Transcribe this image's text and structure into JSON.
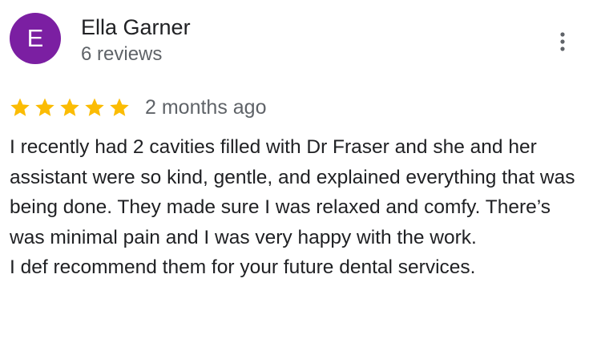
{
  "review": {
    "author": {
      "avatar_letter": "E",
      "avatar_color": "#7b1fa2",
      "name": "Ella Garner",
      "review_count": "6 reviews"
    },
    "more_options_icon": "more-vert-icon",
    "rating": {
      "stars": 5,
      "max": 5,
      "star_icon": "star-icon",
      "star_color": "#fbbc04"
    },
    "time_ago": "2 months ago",
    "text_paragraphs": [
      "I recently had 2 cavities filled with Dr Fraser and she and her assistant were so kind, gentle, and explained everything that was being done. They made sure I was relaxed and comfy. There’s was minimal pain and I was very happy with the work.",
      "I def recommend them for your future dental services."
    ]
  }
}
